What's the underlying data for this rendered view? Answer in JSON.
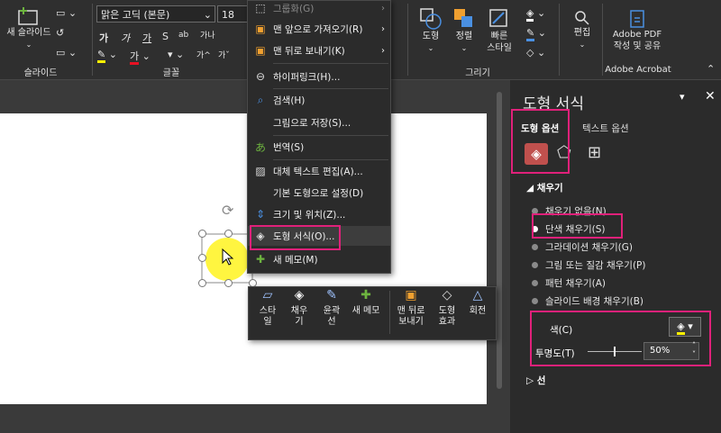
{
  "ribbon": {
    "new_slide_label": "새 슬라이드",
    "group_slide": "슬라이드",
    "group_font": "글꼴",
    "group_draw": "그리기",
    "font_name": "맑은 고딕 (본문)",
    "font_size": "18",
    "shape_label": "도형",
    "arrange_label": "정렬",
    "quick_style_label": "빠른\n스타일",
    "edit_label": "편집",
    "adobe_label": "Adobe PDF\n작성 및 공유",
    "group_adobe": "Adobe Acrobat",
    "bold": "가",
    "italic": "가",
    "underline": "가",
    "strike": "S",
    "spacing": "ab",
    "case": "가나",
    "grow": "가",
    "shrink": "가"
  },
  "context_menu": {
    "items": [
      {
        "label": "그룹화(G)",
        "icon": "group-icon",
        "disabled": true,
        "submenu": true
      },
      {
        "label": "맨 앞으로 가져오기(R)",
        "icon": "bring-front-icon",
        "submenu": true
      },
      {
        "label": "맨 뒤로 보내기(K)",
        "icon": "send-back-icon",
        "submenu": true
      },
      {
        "label": "하이퍼링크(H)...",
        "icon": "link-icon"
      },
      {
        "label": "검색(H)",
        "icon": "search-icon"
      },
      {
        "label": "그림으로 저장(S)...",
        "icon": ""
      },
      {
        "label": "번역(S)",
        "icon": "translate-icon"
      },
      {
        "label": "대체 텍스트 편집(A)...",
        "icon": "alt-text-icon"
      },
      {
        "label": "기본 도형으로 설정(D)",
        "icon": ""
      },
      {
        "label": "크기 및 위치(Z)...",
        "icon": "size-icon"
      },
      {
        "label": "도형 서식(O)...",
        "icon": "format-shape-icon"
      },
      {
        "label": "새 메모(M)",
        "icon": "comment-icon"
      }
    ]
  },
  "mini_toolbar": {
    "items": [
      {
        "label": "스타\n일",
        "icon": "style-icon"
      },
      {
        "label": "채우\n기",
        "icon": "fill-icon"
      },
      {
        "label": "윤곽\n선",
        "icon": "outline-icon"
      },
      {
        "label": "새 메모",
        "icon": "comment-icon"
      },
      {
        "label": "맨 뒤로\n보내기",
        "icon": "send-back-icon"
      },
      {
        "label": "도형\n효과",
        "icon": "effects-icon"
      },
      {
        "label": "회전",
        "icon": "rotate-icon"
      }
    ]
  },
  "pane": {
    "title": "도형 서식",
    "tab_shape_options": "도형 옵션",
    "tab_text_options": "텍스트 옵션",
    "fill_section": "채우기",
    "fill_options": [
      {
        "label": "채우기 없음(N)",
        "selected": false
      },
      {
        "label": "단색 채우기(S)",
        "selected": true
      },
      {
        "label": "그라데이션 채우기(G)",
        "selected": false
      },
      {
        "label": "그림 또는 질감 채우기(P)",
        "selected": false
      },
      {
        "label": "패턴 채우기(A)",
        "selected": false
      },
      {
        "label": "슬라이드 배경 채우기(B)",
        "selected": false
      }
    ],
    "color_label": "색(C)",
    "transparency_label": "투명도(T)",
    "transparency_value": "50%",
    "transparency_fraction": 0.5,
    "line_section": "선"
  },
  "colors": {
    "highlight": "#e0217a",
    "fill_yellow": "#fff200",
    "accent_blue": "#4a90e2"
  }
}
